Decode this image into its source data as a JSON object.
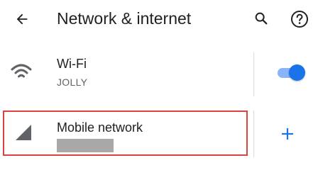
{
  "header": {
    "title": "Network & internet",
    "icons": {
      "back": "arrow-back",
      "search": "search",
      "help": "help-circle"
    }
  },
  "wifi": {
    "label": "Wi-Fi",
    "network": "JOLLY",
    "enabled": true,
    "icon": "wifi"
  },
  "mobile": {
    "label": "Mobile network",
    "subtitle_redacted": true,
    "icon": "cellular-signal",
    "action_icon": "plus"
  },
  "colors": {
    "accent": "#1a73e8",
    "highlight_border": "#d9443f",
    "text_primary": "#202124",
    "text_secondary": "#5f6368"
  }
}
